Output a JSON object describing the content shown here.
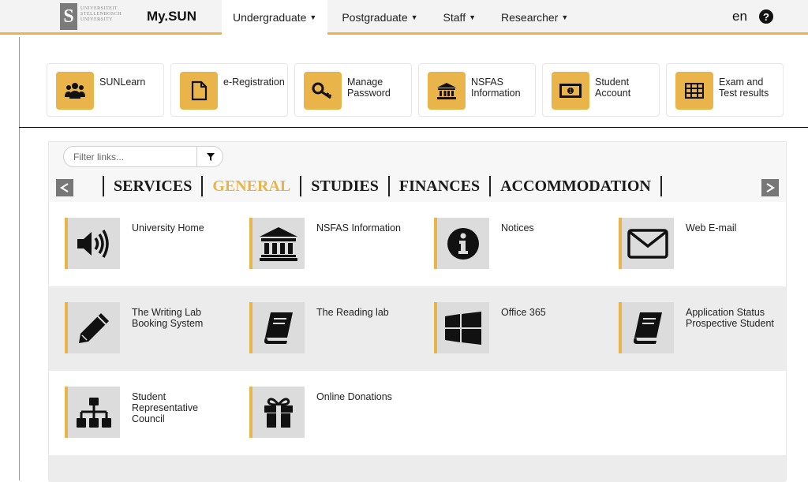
{
  "header": {
    "logo_lines": [
      "UNIVERSITEIT",
      "STELLENBOSCH",
      "UNIVERSITY"
    ],
    "brand": "My.SUN",
    "tabs": [
      {
        "label": "Undergraduate"
      },
      {
        "label": "Postgraduate"
      },
      {
        "label": "Staff"
      },
      {
        "label": "Researcher"
      }
    ],
    "language": "en"
  },
  "quick_links": [
    {
      "label": "SUNLearn",
      "icon": "users-icon"
    },
    {
      "label": "e-Registration",
      "icon": "document-icon"
    },
    {
      "label": "Manage Password",
      "icon": "key-icon"
    },
    {
      "label": "NSFAS Information",
      "icon": "bank-icon"
    },
    {
      "label": "Student Account",
      "icon": "money-icon"
    },
    {
      "label": "Exam and Test results",
      "icon": "table-icon"
    }
  ],
  "filter": {
    "placeholder": "Filter links..."
  },
  "categories": [
    "SERVICES",
    "GENERAL",
    "STUDIES",
    "FINANCES",
    "ACCOMMODATION"
  ],
  "active_category": "GENERAL",
  "links": [
    {
      "label": "University Home",
      "icon": "volume-icon"
    },
    {
      "label": "NSFAS Information",
      "icon": "bank-icon"
    },
    {
      "label": "Notices",
      "icon": "info-icon"
    },
    {
      "label": "Web E-mail",
      "icon": "envelope-icon"
    },
    {
      "label": "The Writing Lab Booking System",
      "icon": "pencil-icon"
    },
    {
      "label": "The Reading lab",
      "icon": "book-icon"
    },
    {
      "label": "Office 365",
      "icon": "windows-icon"
    },
    {
      "label": "Application Status Prospective Student",
      "icon": "book-icon"
    },
    {
      "label": "Student Representative Council",
      "icon": "sitemap-icon"
    },
    {
      "label": "Online Donations",
      "icon": "gift-icon"
    }
  ],
  "colors": {
    "accent": "#e9b54a",
    "tile_bg": "#dcdcdc",
    "row_gray": "#ececec"
  }
}
